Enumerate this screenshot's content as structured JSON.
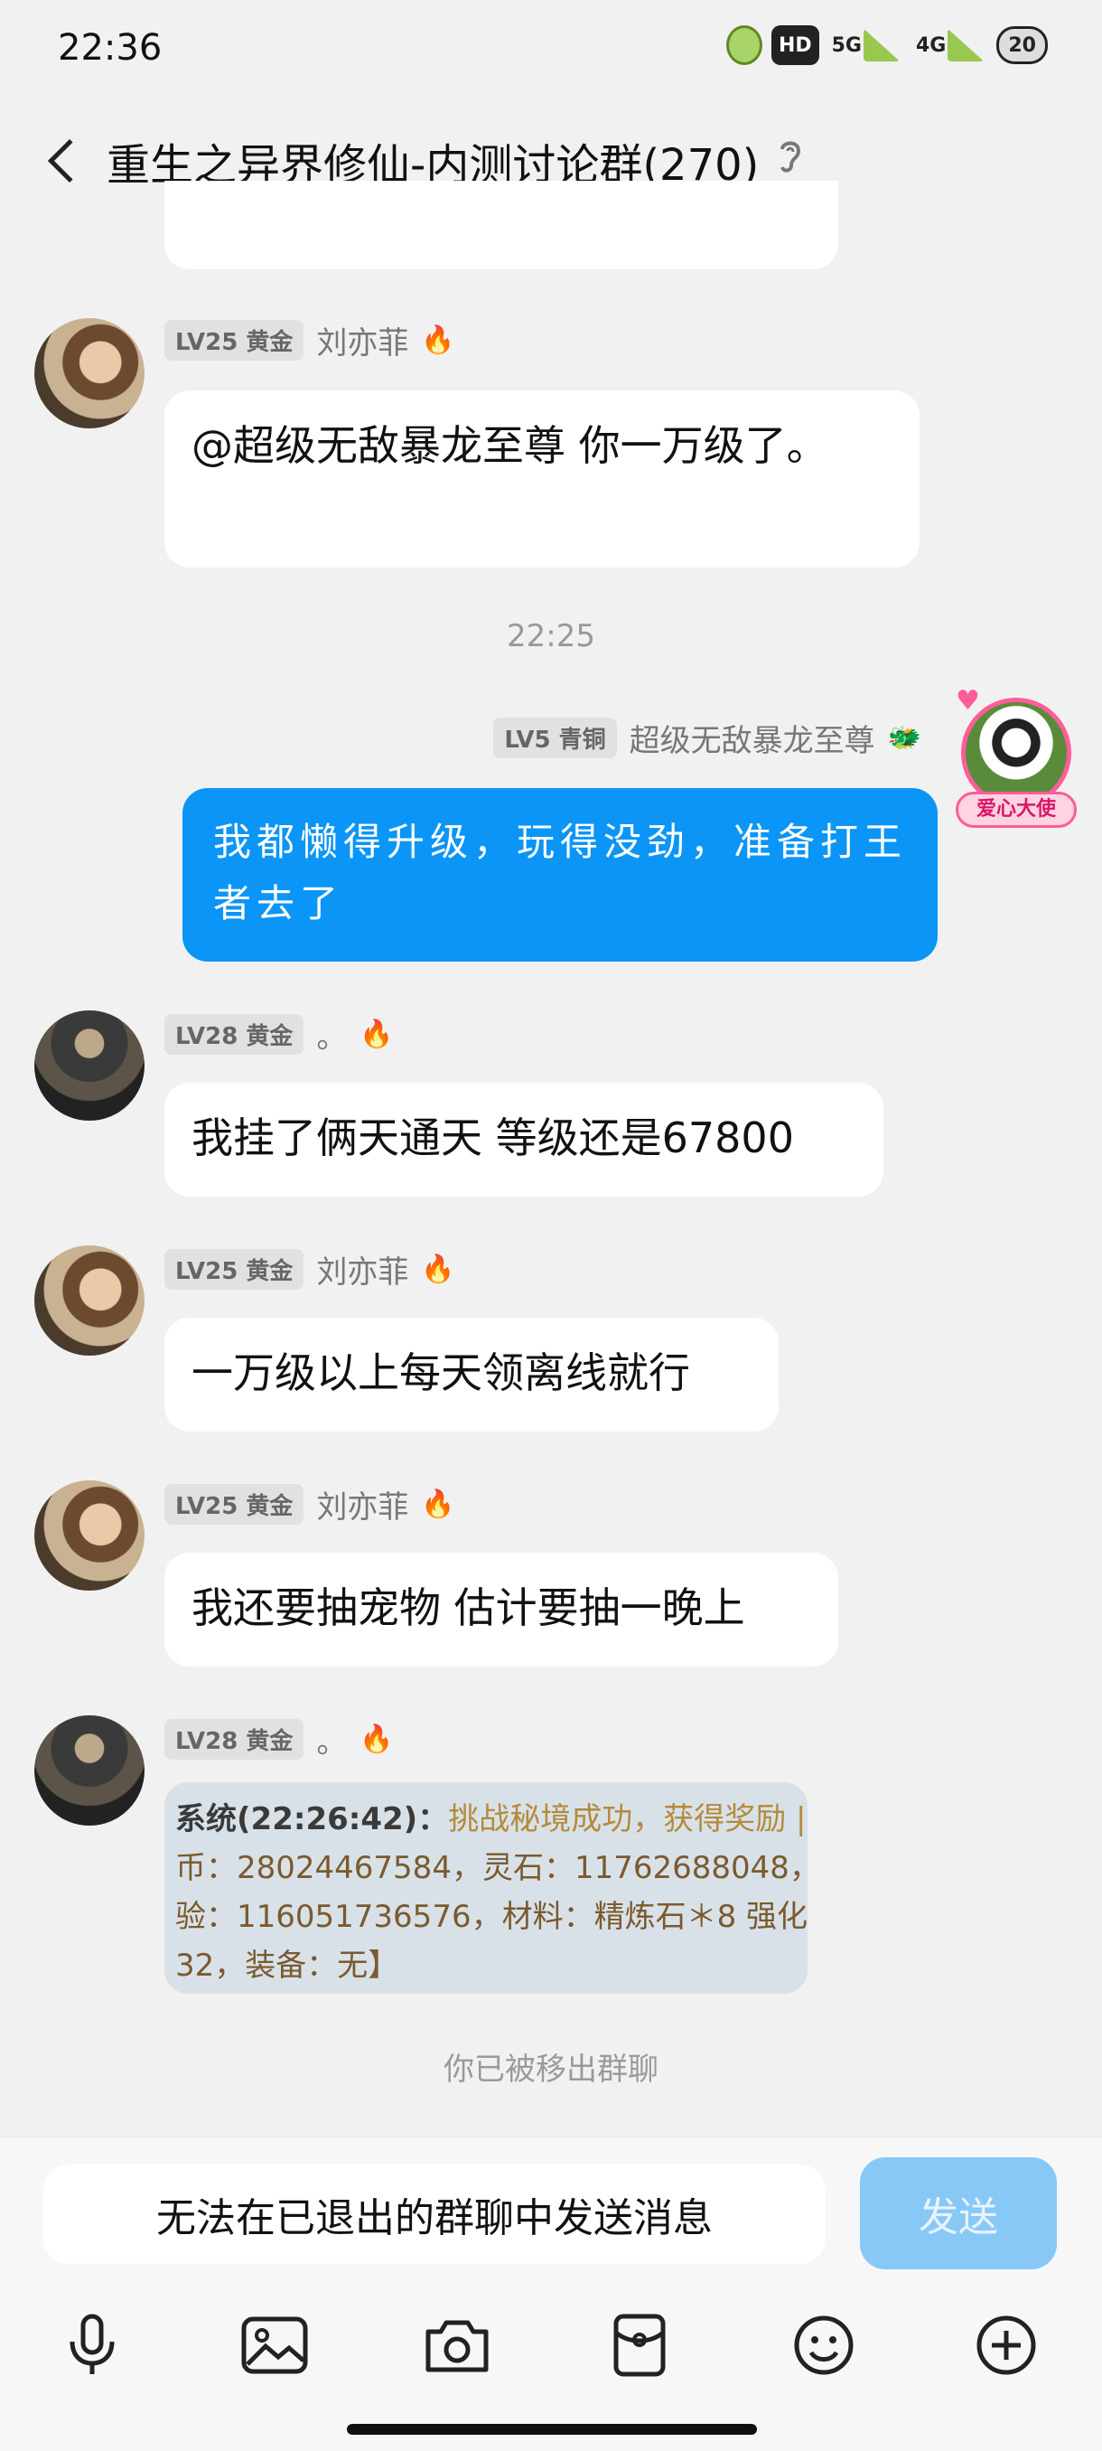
{
  "status_bar": {
    "time": "22:36",
    "hd_label": "HD",
    "net1_label": "5G",
    "net2_label": "4G",
    "battery_label": "20"
  },
  "header": {
    "title": "重生之异界修仙-内测讨论群(270)"
  },
  "messages": [
    {
      "level": "LV25 黄金",
      "name": "刘亦菲",
      "text": "@超级无敌暴龙至尊 你一万级了。"
    },
    {
      "level": "LV5 青铜",
      "name": "超级无敌暴龙至尊",
      "text": "我都懒得升级，玩得没劲，准备打王者去了",
      "avatar_badge": "爱心大使"
    },
    {
      "level": "LV28 黄金",
      "name": "。",
      "text": "我挂了俩天通天 等级还是67800"
    },
    {
      "level": "LV25 黄金",
      "name": "刘亦菲",
      "text": "一万级以上每天领离线就行"
    },
    {
      "level": "LV25 黄金",
      "name": "刘亦菲",
      "text": "我还要抽宠物 估计要抽一晚上"
    },
    {
      "level": "LV28 黄金",
      "name": "。"
    }
  ],
  "time_separator": "22:25",
  "image_message": {
    "line1_sys": "系统(22:26:42)：",
    "line1_text": "挑战秘境成功，获得奖励 |",
    "line2": "币：28024467584，灵石：11762688048，",
    "line3": "验：116051736576，材料：精炼石＊8 强化",
    "line4": "32，装备：无】"
  },
  "notice": "你已被移出群聊",
  "input": {
    "placeholder": "无法在已退出的群聊中发送消息",
    "send_label": "发送"
  },
  "toolbar": [
    "microphone-icon",
    "image-icon",
    "camera-icon",
    "red-packet-icon",
    "emoji-icon",
    "plus-icon"
  ],
  "colors": {
    "self_bubble": "#0b95f7",
    "background": "#f1f1f1",
    "send_button_disabled": "#88c8f7"
  }
}
